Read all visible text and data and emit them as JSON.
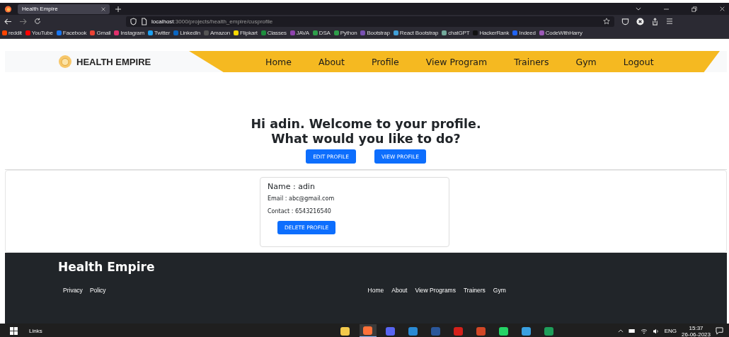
{
  "browser": {
    "tabs": [
      {
        "title": "Health Empire",
        "selected": true
      }
    ],
    "url_host": "localhost",
    "url_path": ":3000/projects/health_empire/cusprofile",
    "bookmarks": [
      {
        "label": "reddit",
        "color": "#ff4500"
      },
      {
        "label": "YouTube",
        "color": "#ff0000"
      },
      {
        "label": "Facebook",
        "color": "#1877f2"
      },
      {
        "label": "Gmail",
        "color": "#ea4335"
      },
      {
        "label": "Instagram",
        "color": "#e1306c"
      },
      {
        "label": "Twitter",
        "color": "#1da1f2"
      },
      {
        "label": "LinkedIn",
        "color": "#0a66c2"
      },
      {
        "label": "Amazon",
        "color": "#555555"
      },
      {
        "label": "Flipkart",
        "color": "#f8d800"
      },
      {
        "label": "Classes",
        "color": "#1e8e3e"
      },
      {
        "label": "JAVA",
        "color": "#8e44ad"
      },
      {
        "label": "DSA",
        "color": "#2e9e4a"
      },
      {
        "label": "Python",
        "color": "#2e9e4a"
      },
      {
        "label": "Bootstrap",
        "color": "#7952b3"
      },
      {
        "label": "React Bootstrap",
        "color": "#41a0d8"
      },
      {
        "label": "chatGPT",
        "color": "#74aa9c"
      },
      {
        "label": "HackerRank",
        "color": "#111111"
      },
      {
        "label": "Indeed",
        "color": "#2164f3"
      },
      {
        "label": "CodeWithHarry",
        "color": "#9b59b6"
      }
    ]
  },
  "navbar": {
    "brand": "HEALTH EMPIRE",
    "links": [
      "Home",
      "About",
      "Profile",
      "View Program",
      "Trainers",
      "Gym",
      "Logout"
    ]
  },
  "welcome": {
    "line_1": "Hi adin. Welcome to your profile.",
    "line_2": "What would you like to do?",
    "buttons": [
      "EDIT PROFILE",
      "VIEW PROFILE"
    ]
  },
  "profile_card": {
    "name": "Name : adin",
    "email": "Email : abc@gmail.com",
    "contact": "Contact : 6543216540",
    "button": "DELETE PROFILE"
  },
  "footer": {
    "title": "Health Empire",
    "left_links": [
      "Privacy",
      "Policy"
    ],
    "right_links": [
      "Home",
      "About",
      "View Programs",
      "Trainers",
      "Gym"
    ]
  },
  "taskbar": {
    "search_label": "Links",
    "apps": [
      {
        "color": "#f2c94c",
        "selected": false
      },
      {
        "color": "#ff7139",
        "selected": true
      },
      {
        "color": "#5865f2",
        "selected": false
      },
      {
        "color": "#2a8ad4",
        "selected": false
      },
      {
        "color": "#2b579a",
        "selected": false
      },
      {
        "color": "#d4201a",
        "selected": false
      },
      {
        "color": "#d24726",
        "selected": false
      },
      {
        "color": "#25d366",
        "selected": false
      },
      {
        "color": "#3aa0e0",
        "selected": false
      },
      {
        "color": "#1e9e5a",
        "selected": false
      }
    ],
    "lang": "ENG",
    "time": "15:37",
    "date": "26-06-2023"
  }
}
